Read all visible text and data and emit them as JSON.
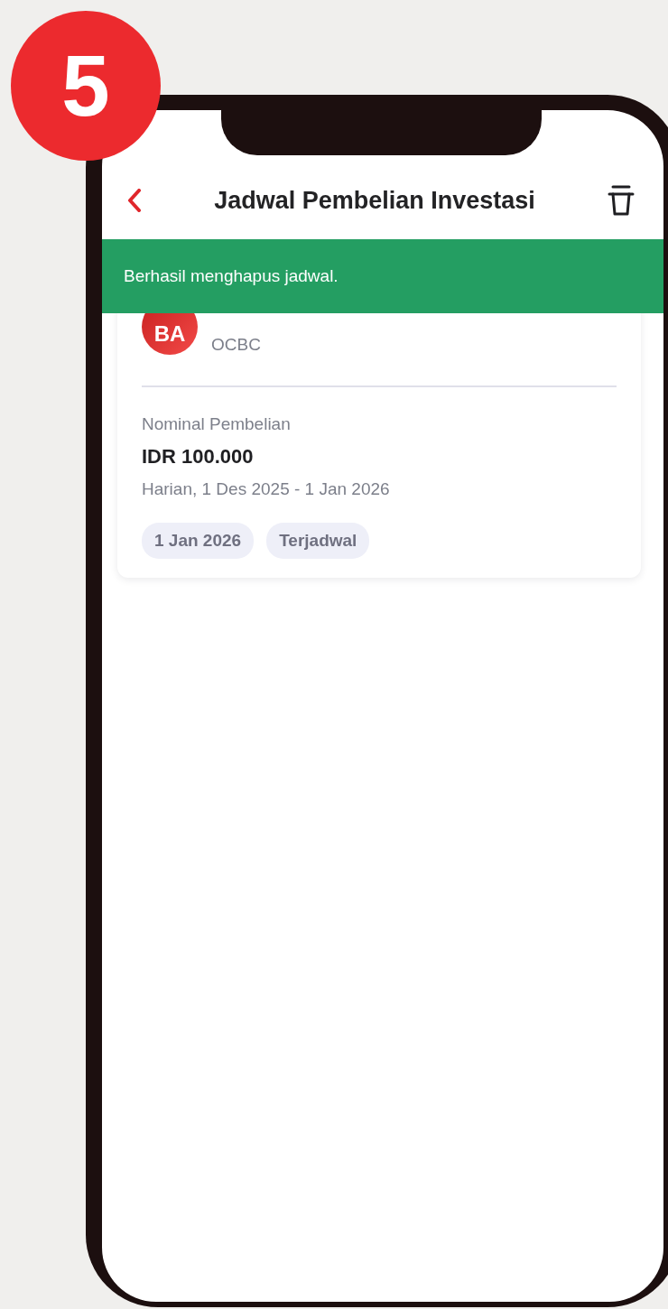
{
  "step_badge": "5",
  "header": {
    "title": "Jadwal Pembelian Investasi"
  },
  "banner": {
    "message": "Berhasil menghapus jadwal."
  },
  "schedule_card": {
    "avatar_initials": "BA",
    "provider": "OCBC",
    "amount_label": "Nominal Pembelian",
    "amount": "IDR 100.000",
    "frequency": "Harian, 1 Des 2025 - 1 Jan 2026",
    "chips": [
      "1 Jan 2026",
      "Terjadwal"
    ]
  }
}
